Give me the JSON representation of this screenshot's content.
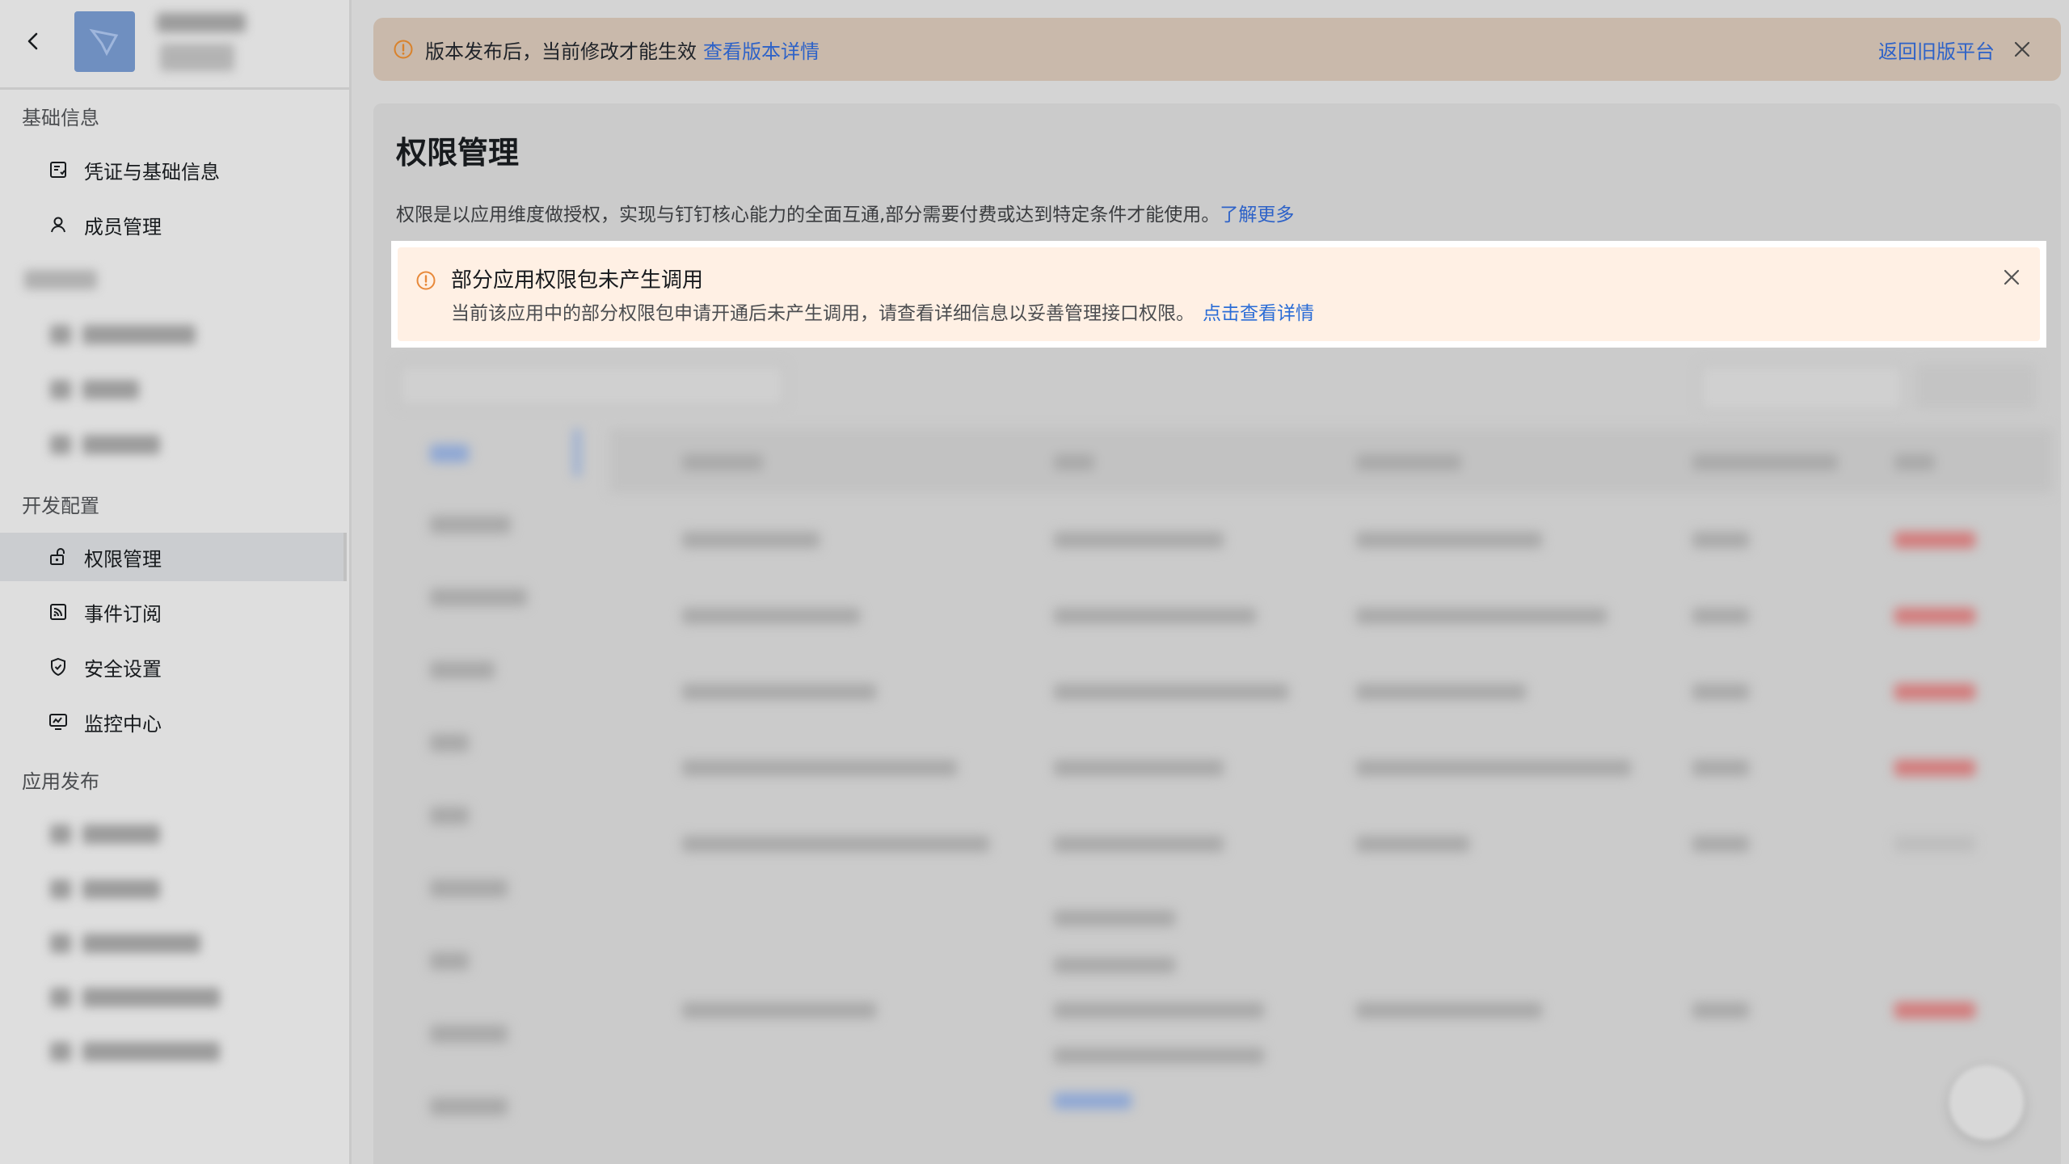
{
  "top_notice": {
    "message": "版本发布后，当前修改才能生效",
    "link": "查看版本详情",
    "return_link": "返回旧版平台"
  },
  "sidebar": {
    "sections": [
      {
        "title": "基础信息",
        "items": [
          {
            "label": "凭证与基础信息",
            "icon": "credential-icon"
          },
          {
            "label": "成员管理",
            "icon": "user-icon"
          }
        ]
      },
      {
        "title": "开发配置",
        "items": [
          {
            "label": "权限管理",
            "icon": "unlock-icon",
            "active": true
          },
          {
            "label": "事件订阅",
            "icon": "rss-icon"
          },
          {
            "label": "安全设置",
            "icon": "shield-icon"
          },
          {
            "label": "监控中心",
            "icon": "monitor-icon"
          }
        ]
      },
      {
        "title": "应用发布",
        "items": []
      }
    ]
  },
  "page": {
    "title": "权限管理",
    "description": "权限是以应用维度做授权，实现与钉钉核心能力的全面互通,部分需要付费或达到特定条件才能使用。",
    "learn_more": "了解更多"
  },
  "alert": {
    "title": "部分应用权限包未产生调用",
    "body": "当前该应用中的部分权限包申请开通后未产生调用，请查看详细信息以妥善管理接口权限。",
    "link": "点击查看详情"
  },
  "colors": {
    "accent": "#2a6cd6",
    "warning": "#e8893a",
    "alert_bg": "#fff0e4"
  }
}
